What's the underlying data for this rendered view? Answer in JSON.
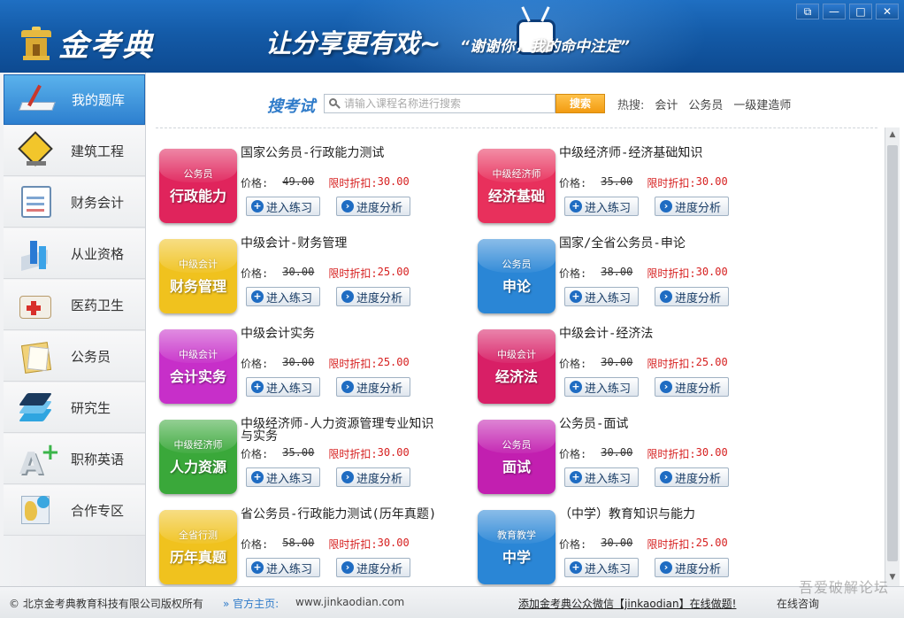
{
  "window": {
    "brand": "金考典",
    "slogan": "让分享更有戏~",
    "slogan2": "“谢谢你，我的命中注定”",
    "controls": [
      "⧉",
      "—",
      "□",
      "✕"
    ]
  },
  "sidebar": {
    "items": [
      {
        "label": "我的题库",
        "icon": "book-pen-icon",
        "active": true
      },
      {
        "label": "建筑工程",
        "icon": "construction-sign-icon"
      },
      {
        "label": "财务会计",
        "icon": "clipboard-chart-icon"
      },
      {
        "label": "从业资格",
        "icon": "bar-chart-icon"
      },
      {
        "label": "医药卫生",
        "icon": "medical-kit-icon"
      },
      {
        "label": "公务员",
        "icon": "folder-documents-icon"
      },
      {
        "label": "研究生",
        "icon": "layers-icon"
      },
      {
        "label": "职称英语",
        "icon": "a-plus-icon"
      },
      {
        "label": "合作专区",
        "icon": "map-pin-icon"
      }
    ]
  },
  "search": {
    "title": "搜考试",
    "placeholder": "请输入课程名称进行搜索",
    "button": "搜索",
    "hot_label": "热搜:",
    "hot_links": [
      "会计",
      "公务员",
      "一级建造师"
    ]
  },
  "labels": {
    "price": "价格:",
    "sale": "限时折扣:",
    "practice": "进入练习",
    "progress": "进度分析"
  },
  "courses": [
    {
      "sub": "公务员",
      "main": "行政能力",
      "title": "国家公务员-行政能力测试",
      "old": "49.00",
      "sale": "30.00",
      "color": "#e0245c"
    },
    {
      "sub": "中级经济师",
      "main": "经济基础",
      "title": "中级经济师-经济基础知识",
      "old": "35.00",
      "sale": "30.00",
      "color": "#e8305c"
    },
    {
      "sub": "中级会计",
      "main": "财务管理",
      "title": "中级会计-财务管理",
      "old": "30.00",
      "sale": "25.00",
      "color": "#f0c21e"
    },
    {
      "sub": "公务员",
      "main": "申论",
      "title": "国家/全省公务员-申论",
      "old": "38.00",
      "sale": "30.00",
      "color": "#2a86d6"
    },
    {
      "sub": "中级会计",
      "main": "会计实务",
      "title": "中级会计实务",
      "old": "30.00",
      "sale": "25.00",
      "color": "#c72fc9"
    },
    {
      "sub": "中级会计",
      "main": "经济法",
      "title": "中级会计-经济法",
      "old": "30.00",
      "sale": "25.00",
      "color": "#d81f66"
    },
    {
      "sub": "中级经济师",
      "main": "人力资源",
      "title": "中级经济师-人力资源管理专业知识与实务",
      "old": "35.00",
      "sale": "30.00",
      "color": "#3aa83a"
    },
    {
      "sub": "公务员",
      "main": "面试",
      "title": "公务员-面试",
      "old": "30.00",
      "sale": "30.00",
      "color": "#c21fb0"
    },
    {
      "sub": "全省行测",
      "main": "历年真题",
      "title": "省公务员-行政能力测试(历年真题)",
      "old": "58.00",
      "sale": "30.00",
      "color": "#f0c21e"
    },
    {
      "sub": "教育教学",
      "main": "中学",
      "title": "（中学）教育知识与能力",
      "old": "30.00",
      "sale": "25.00",
      "color": "#2a86d6"
    }
  ],
  "footer": {
    "copyright": "© 北京金考典教育科技有限公司版权所有",
    "homepage_label": "» 官方主页:",
    "homepage_url": "www.jinkaodian.com",
    "wechat": "添加金考典公众微信【jinkaodian】在线做题!",
    "online": "在线咨询",
    "watermark": "吾爱破解论坛"
  }
}
